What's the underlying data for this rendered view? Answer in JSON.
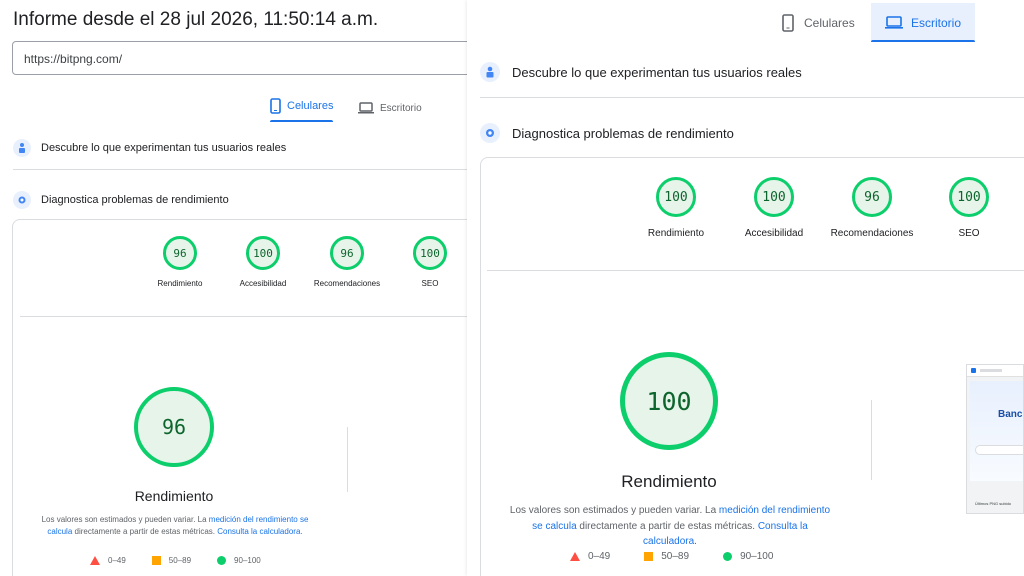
{
  "header": {
    "title": "Informe desde el 28 jul 2026, 11:50:14 a.m.",
    "url": "https://bitpng.com/"
  },
  "tabs": {
    "mobile": "Celulares",
    "desktop": "Escritorio"
  },
  "sections": {
    "field_data": "Descubre lo que experimentan tus usuarios reales",
    "diagnose": "Diagnostica problemas de rendimiento"
  },
  "mobile": {
    "scores": [
      {
        "value": "96",
        "label": "Rendimiento"
      },
      {
        "value": "100",
        "label": "Accesibilidad"
      },
      {
        "value": "96",
        "label": "Recomendaciones"
      },
      {
        "value": "100",
        "label": "SEO"
      }
    ],
    "main_score": "96",
    "main_label": "Rendimiento"
  },
  "desktop": {
    "scores": [
      {
        "value": "100",
        "label": "Rendimiento"
      },
      {
        "value": "100",
        "label": "Accesibilidad"
      },
      {
        "value": "96",
        "label": "Recomendaciones"
      },
      {
        "value": "100",
        "label": "SEO"
      }
    ],
    "main_score": "100",
    "main_label": "Rendimiento",
    "thumb_heading": "Banc",
    "thumb_caption": "Últimos PNG subido"
  },
  "note": {
    "text1": "Los valores son estimados y pueden variar. La ",
    "link1": "medición del rendimiento se calcula",
    "text2": " directamente a partir de estas métricas. ",
    "link2": "Consulta la calculadora."
  },
  "legend": {
    "poor": "0–49",
    "average": "50–89",
    "good": "90–100"
  },
  "colors": {
    "pass": "#0cce6b",
    "average": "#ffa400",
    "fail": "#ff4e42",
    "accent": "#1a73e8"
  }
}
